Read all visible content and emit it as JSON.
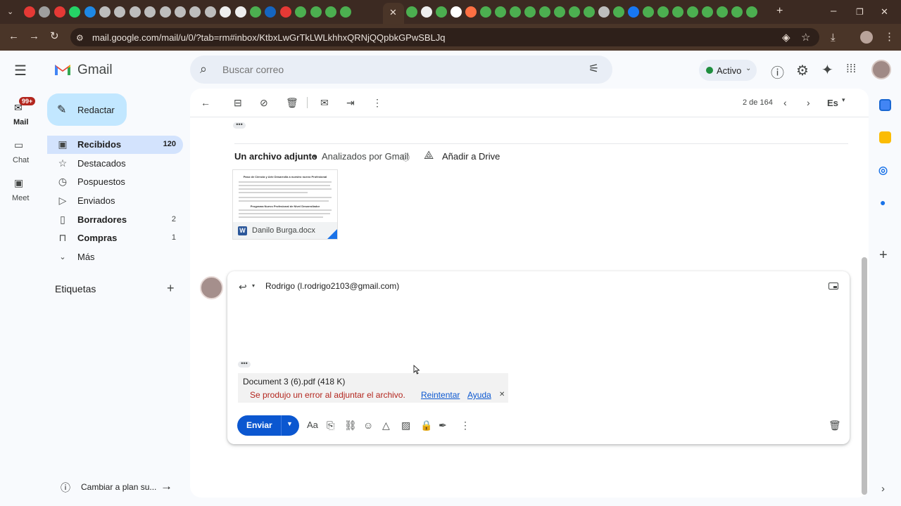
{
  "browser": {
    "url": "mail.google.com/mail/u/0/?tab=rm#inbox/KtbxLwGrTkLWLkhhxQRNjQQpbkGPwSBLJq"
  },
  "app": {
    "name": "Gmail"
  },
  "search": {
    "placeholder": "Buscar correo"
  },
  "header": {
    "status": "Activo",
    "status_color": "#1e8e3e"
  },
  "rail": [
    {
      "label": "Mail",
      "badge": "99+"
    },
    {
      "label": "Chat"
    },
    {
      "label": "Meet"
    }
  ],
  "sidebar": {
    "compose": "Redactar",
    "items": [
      {
        "label": "Recibidos",
        "count": "120"
      },
      {
        "label": "Destacados",
        "count": ""
      },
      {
        "label": "Pospuestos",
        "count": ""
      },
      {
        "label": "Enviados",
        "count": ""
      },
      {
        "label": "Borradores",
        "count": "2"
      },
      {
        "label": "Compras",
        "count": "1"
      },
      {
        "label": "Más",
        "count": ""
      }
    ],
    "labels_title": "Etiquetas",
    "upgrade": "Cambiar a plan su..."
  },
  "toolbar": {
    "pagination": "2 de 164",
    "lang": "Es"
  },
  "attachments": {
    "summary": "Un archivo adjunto",
    "scanned": "Analizados por Gmail",
    "add_drive": "Añadir a Drive",
    "file_name": "Danilo Burga.docx",
    "preview_title": "Paso de Ciencia y Arte Desarrolla a nuestro nuevo Profesional",
    "preview_subtitle": "Programa Nuevo Profesional de Nivel Desarrollador"
  },
  "reply": {
    "recipient": "Rodrigo (l.rodrigo2103@gmail.com)",
    "attachment_name": "Document 3 (6).pdf (418 K)",
    "error": "Se produjo un error al adjuntar el archivo.",
    "retry": "Reintentar",
    "help": "Ayuda",
    "send": "Enviar"
  },
  "colors": {
    "accent": "#0b57d0",
    "error": "#b3261e",
    "gmail_red": "#ea4335"
  }
}
